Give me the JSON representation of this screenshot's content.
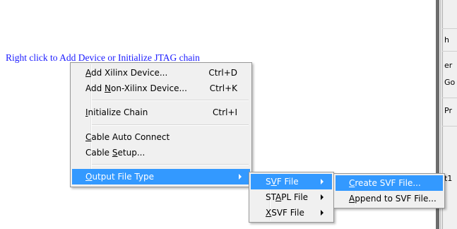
{
  "hint_text": "Right click to Add Device or Initialize JTAG chain",
  "main_menu": {
    "items": [
      {
        "pre": "",
        "ul": "A",
        "post": "dd Xilinx Device...",
        "shortcut": "Ctrl+D"
      },
      {
        "pre": "Add ",
        "ul": "N",
        "post": "on-Xilinx Device...",
        "shortcut": "Ctrl+K"
      },
      {
        "pre": "",
        "ul": "I",
        "post": "nitialize Chain",
        "shortcut": "Ctrl+I"
      },
      {
        "pre": "",
        "ul": "C",
        "post": "able Auto Connect",
        "shortcut": ""
      },
      {
        "pre": "Cable ",
        "ul": "S",
        "post": "etup...",
        "shortcut": ""
      },
      {
        "pre": "",
        "ul": "O",
        "post": "utput File Type",
        "shortcut": ""
      }
    ]
  },
  "output_submenu": {
    "items": [
      {
        "pre": "S",
        "ul": "V",
        "post": "F File"
      },
      {
        "pre": "ST",
        "ul": "A",
        "post": "PL File"
      },
      {
        "pre": "",
        "ul": "X",
        "post": "SVF File"
      }
    ]
  },
  "svf_submenu": {
    "items": [
      {
        "pre": "",
        "ul": "C",
        "post": "reate SVF File..."
      },
      {
        "pre": "",
        "ul": "A",
        "post": "ppend to SVF File..."
      }
    ]
  },
  "background_window": {
    "fragments": [
      "h",
      "er",
      "Go",
      "Pr",
      "t1"
    ]
  },
  "colors": {
    "highlight": "#3399ff",
    "hint_text": "#1a1aff",
    "menu_bg": "#f0f0f0"
  }
}
